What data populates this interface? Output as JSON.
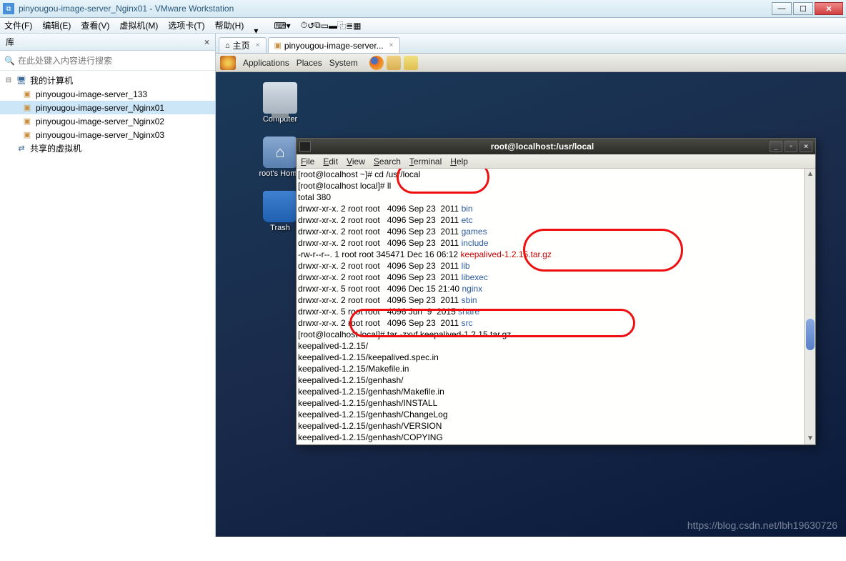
{
  "window": {
    "title": "pinyougou-image-server_Nginx01 - VMware Workstation"
  },
  "menubar": {
    "file": "文件(F)",
    "edit": "编辑(E)",
    "view": "查看(V)",
    "vm": "虚拟机(M)",
    "tabs": "选项卡(T)",
    "help": "帮助(H)"
  },
  "sidebar": {
    "title": "库",
    "search_placeholder": "在此处键入内容进行搜索",
    "tree": {
      "root": "我的计算机",
      "children": [
        "pinyougou-image-server_133",
        "pinyougou-image-server_Nginx01",
        "pinyougou-image-server_Nginx02",
        "pinyougou-image-server_Nginx03"
      ],
      "shared": "共享的虚拟机"
    }
  },
  "tabs": {
    "home": "主页",
    "vm": "pinyougou-image-server..."
  },
  "vm": {
    "menubar": {
      "apps": "Applications",
      "places": "Places",
      "system": "System"
    },
    "desk": {
      "computer": "Computer",
      "home": "root's Home",
      "trash": "Trash"
    }
  },
  "terminal": {
    "title": "root@localhost:/usr/local",
    "menubar": {
      "file": "File",
      "edit": "Edit",
      "view": "View",
      "search": "Search",
      "terminal": "Terminal",
      "help": "Help"
    },
    "lines": [
      {
        "segs": [
          {
            "t": "[root@localhost ~]# "
          },
          {
            "t": "cd /usr/local"
          }
        ]
      },
      {
        "segs": [
          {
            "t": "[root@localhost local]# ll"
          }
        ]
      },
      {
        "segs": [
          {
            "t": "total 380"
          }
        ]
      },
      {
        "segs": [
          {
            "t": "drwxr-xr-x. 2 root root   4096 Sep 23  2011 "
          },
          {
            "t": "bin",
            "c": "tblue"
          }
        ]
      },
      {
        "segs": [
          {
            "t": "drwxr-xr-x. 2 root root   4096 Sep 23  2011 "
          },
          {
            "t": "etc",
            "c": "tblue"
          }
        ]
      },
      {
        "segs": [
          {
            "t": "drwxr-xr-x. 2 root root   4096 Sep 23  2011 "
          },
          {
            "t": "games",
            "c": "tblue"
          }
        ]
      },
      {
        "segs": [
          {
            "t": "drwxr-xr-x. 2 root root   4096 Sep 23  2011 "
          },
          {
            "t": "include",
            "c": "tblue"
          }
        ]
      },
      {
        "segs": [
          {
            "t": "-rw-r--r--. 1 root root 345471 Dec 16 06:12 "
          },
          {
            "t": "keepalived-1.2.15.tar.gz",
            "c": "tred"
          }
        ]
      },
      {
        "segs": [
          {
            "t": "drwxr-xr-x. 2 root root   4096 Sep 23  2011 "
          },
          {
            "t": "lib",
            "c": "tblue"
          }
        ]
      },
      {
        "segs": [
          {
            "t": "drwxr-xr-x. 2 root root   4096 Sep 23  2011 "
          },
          {
            "t": "libexec",
            "c": "tblue"
          }
        ]
      },
      {
        "segs": [
          {
            "t": "drwxr-xr-x. 5 root root   4096 Dec 15 21:40 "
          },
          {
            "t": "nginx",
            "c": "tblue"
          }
        ]
      },
      {
        "segs": [
          {
            "t": "drwxr-xr-x. 2 root root   4096 Sep 23  2011 "
          },
          {
            "t": "sbin",
            "c": "tblue"
          }
        ]
      },
      {
        "segs": [
          {
            "t": "drwxr-xr-x. 5 root root   4096 Jun  9  2015 "
          },
          {
            "t": "share",
            "c": "tblue"
          }
        ]
      },
      {
        "segs": [
          {
            "t": "drwxr-xr-x. 2 root root   4096 Sep 23  2011 "
          },
          {
            "t": "src",
            "c": "tblue"
          }
        ]
      },
      {
        "segs": [
          {
            "t": "[root@localhost local]# tar -zxvf keepalived-1.2.15.tar.gz"
          }
        ]
      },
      {
        "segs": [
          {
            "t": "keepalived-1.2.15/"
          }
        ]
      },
      {
        "segs": [
          {
            "t": "keepalived-1.2.15/keepalived.spec.in"
          }
        ]
      },
      {
        "segs": [
          {
            "t": "keepalived-1.2.15/Makefile.in"
          }
        ]
      },
      {
        "segs": [
          {
            "t": "keepalived-1.2.15/genhash/"
          }
        ]
      },
      {
        "segs": [
          {
            "t": "keepalived-1.2.15/genhash/Makefile.in"
          }
        ]
      },
      {
        "segs": [
          {
            "t": "keepalived-1.2.15/genhash/INSTALL"
          }
        ]
      },
      {
        "segs": [
          {
            "t": "keepalived-1.2.15/genhash/ChangeLog"
          }
        ]
      },
      {
        "segs": [
          {
            "t": "keepalived-1.2.15/genhash/VERSION"
          }
        ]
      },
      {
        "segs": [
          {
            "t": "keepalived-1.2.15/genhash/COPYING"
          }
        ]
      }
    ]
  },
  "watermark": "https://blog.csdn.net/lbh19630726"
}
